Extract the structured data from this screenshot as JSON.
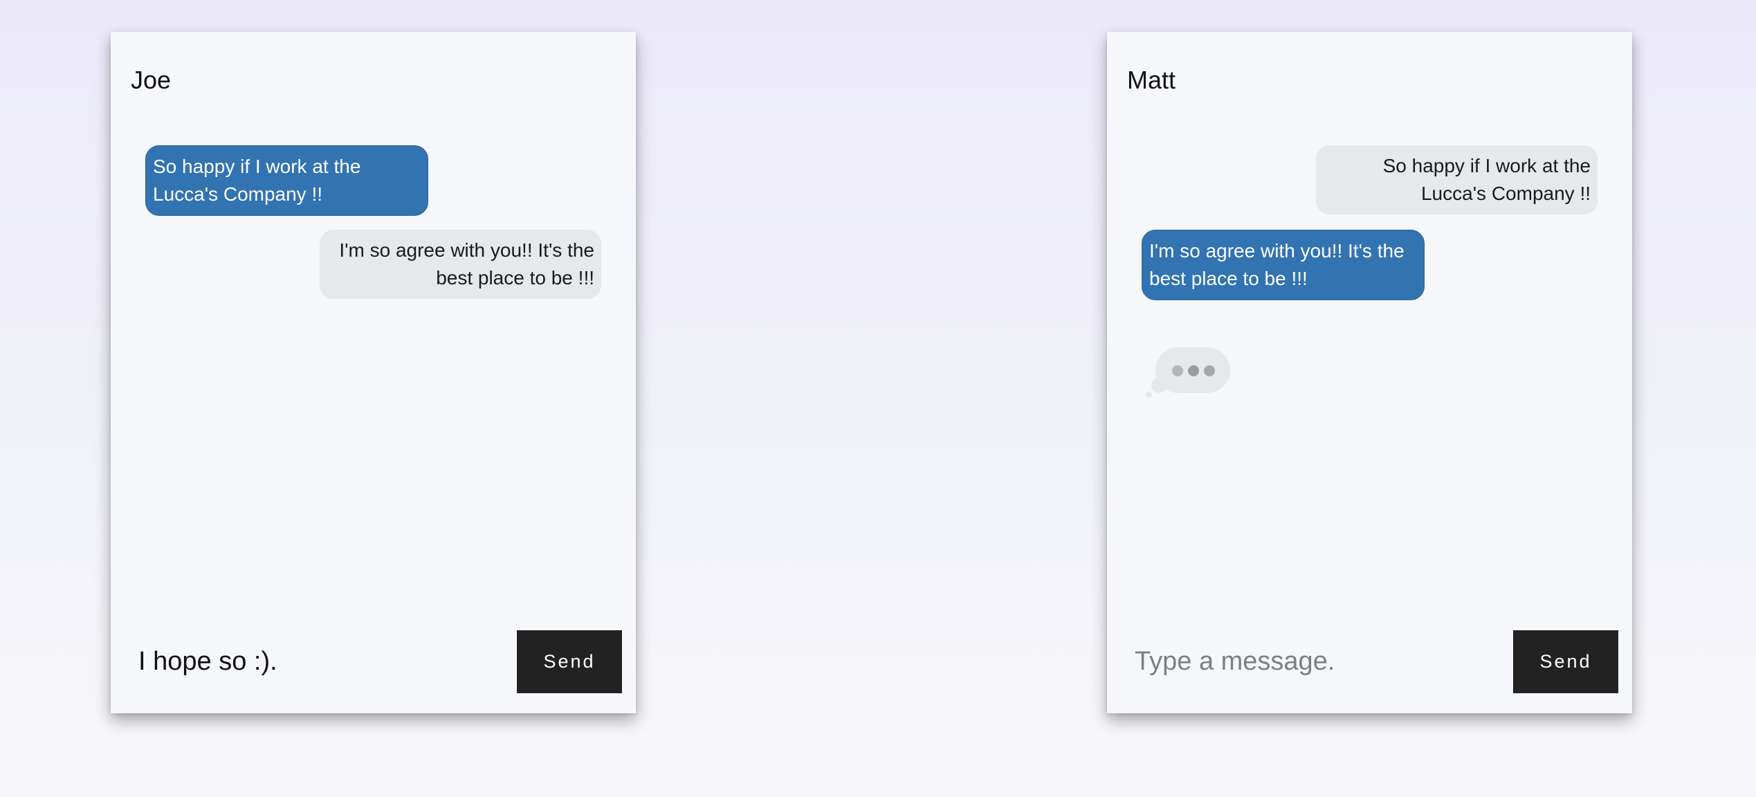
{
  "chats": [
    {
      "title": "Joe",
      "messages": [
        {
          "text": "So happy if I work at the Lucca's Company !!",
          "direction": "sent"
        },
        {
          "text": "I'm so agree with you!! It's the best place to be !!!",
          "direction": "received"
        }
      ],
      "typing_indicator": false,
      "input": {
        "value": "I hope so :).",
        "placeholder": "Type a message."
      },
      "send_label": "Send"
    },
    {
      "title": "Matt",
      "messages": [
        {
          "text": "So happy if I work at the Lucca's Company !!",
          "direction": "received"
        },
        {
          "text": "I'm so agree with you!! It's the best place to be !!!",
          "direction": "sent"
        }
      ],
      "typing_indicator": true,
      "input": {
        "value": "",
        "placeholder": "Type a message."
      },
      "send_label": "Send"
    }
  ],
  "colors": {
    "sent_bubble": "#3273b1",
    "received_bubble": "#e5e9ec",
    "send_button": "#222222",
    "panel_background": "#f5f7fa"
  },
  "icons": {
    "typing": "typing-indicator-icon"
  }
}
